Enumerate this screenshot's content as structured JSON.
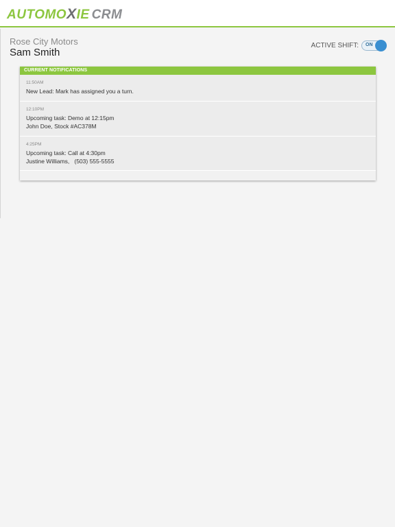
{
  "header": {
    "logo": {
      "part1": "AUTOMO",
      "part2": "X",
      "part3": "IE",
      "part4": "CRM"
    }
  },
  "profile": {
    "dealer": "Rose City Motors",
    "user": "Sam Smith"
  },
  "shift": {
    "label": "ACTIVE SHIFT:",
    "state": "ON"
  },
  "notifications": {
    "title": "CURRENT NOTIFICATIONS",
    "items": [
      {
        "time": "11:50AM",
        "line1": "New Lead: Mark has assigned you a turn."
      },
      {
        "time": "12:10PM",
        "line1": "Upcoming task: Demo at 12:15pm",
        "line2": "John Doe, Stock #AC378M"
      },
      {
        "time": "4:25PM",
        "line1": "Upcoming task: Call at 4:30pm",
        "line2": "Justine Williams,   (503) 555-5555"
      }
    ]
  },
  "colors": {
    "brand_green": "#8cc63f",
    "toggle_blue": "#3a8fd1"
  }
}
